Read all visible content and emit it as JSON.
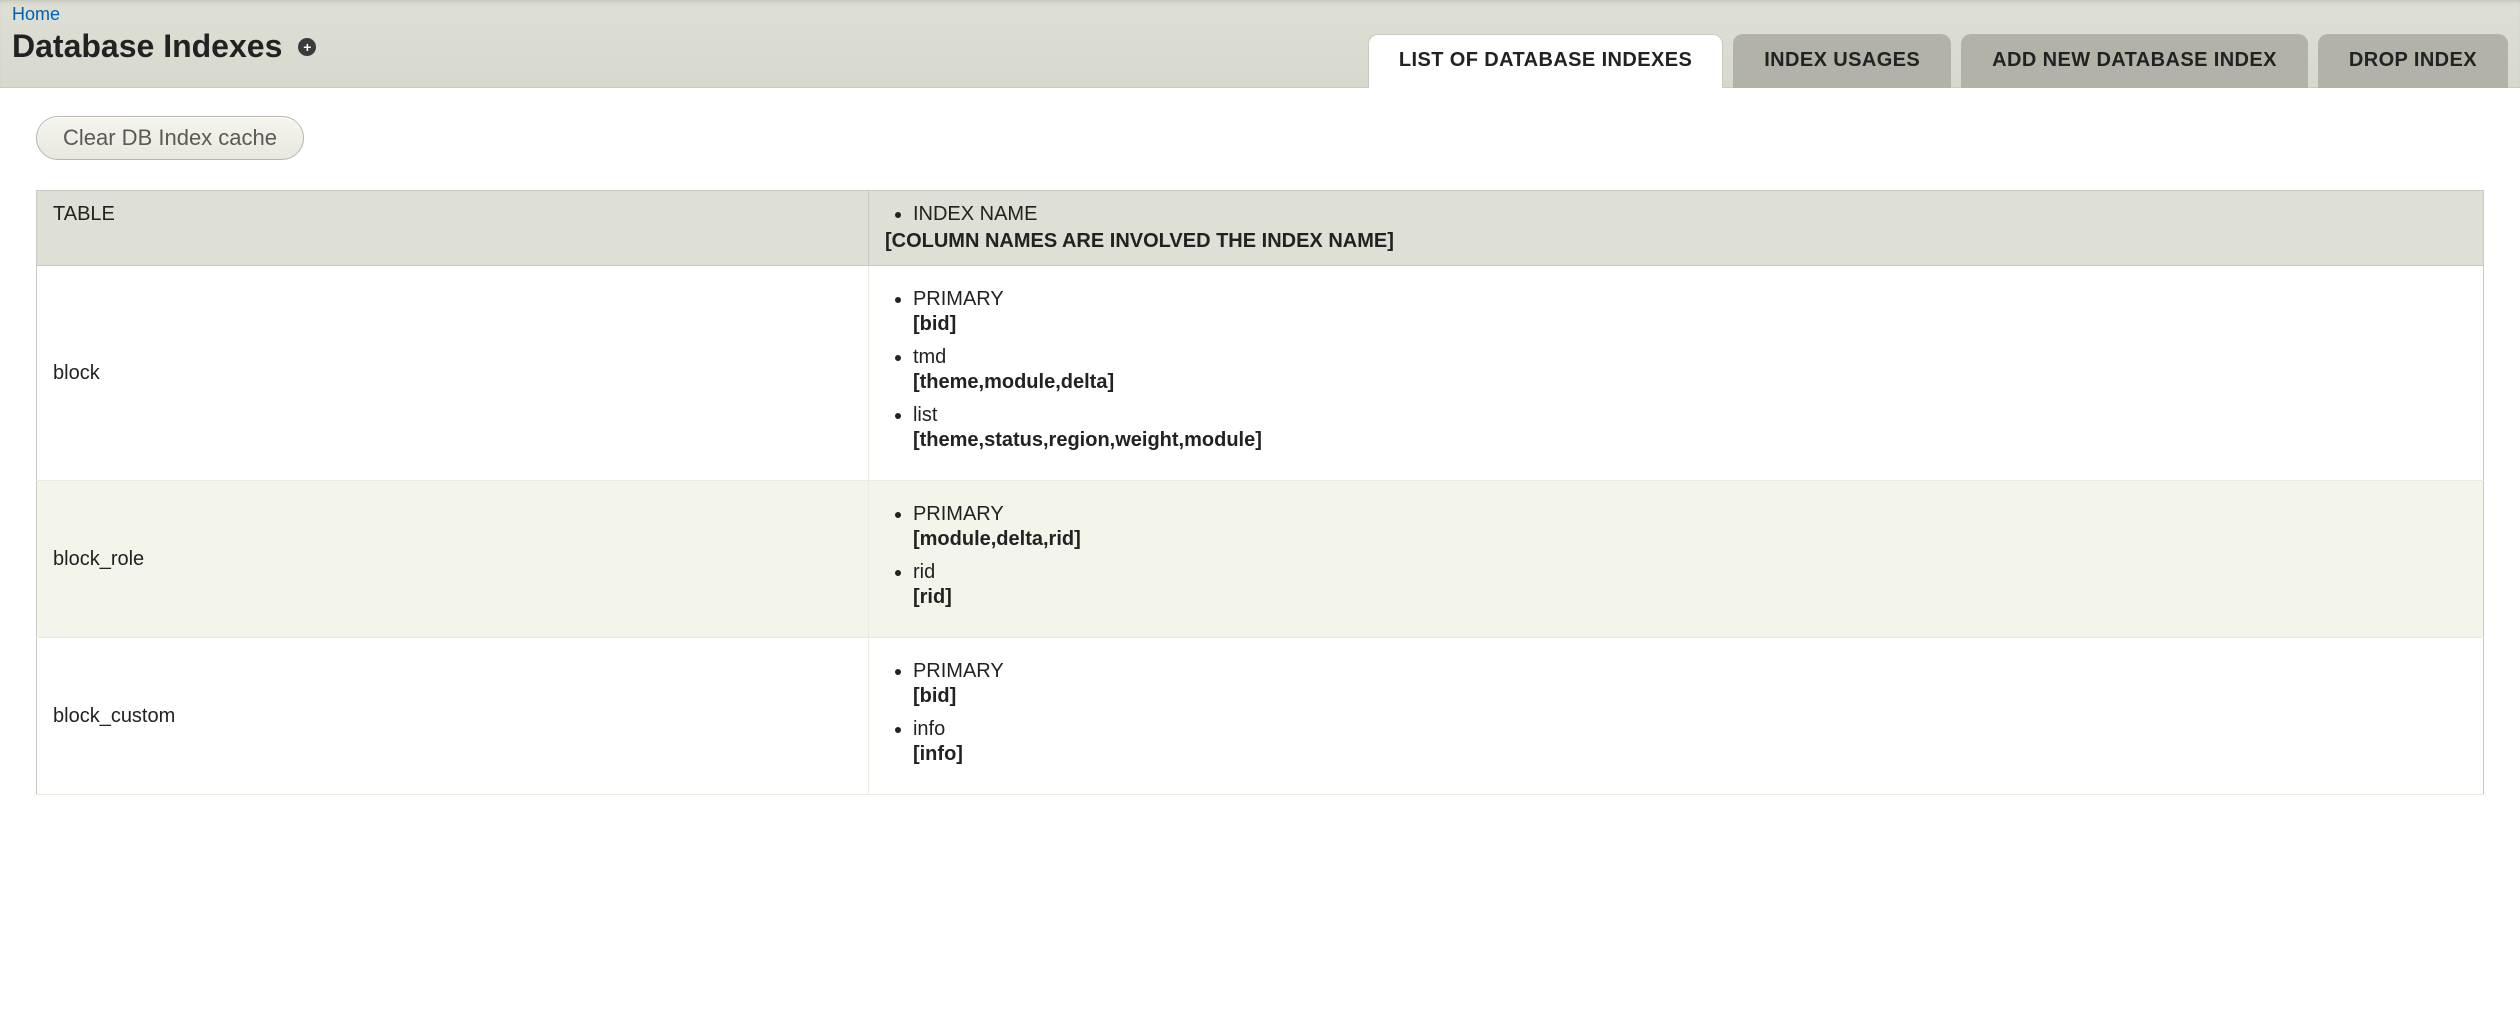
{
  "breadcrumb": {
    "home": "Home"
  },
  "page_title": "Database Indexes",
  "tabs": {
    "list": "LIST OF DATABASE INDEXES",
    "usage": "INDEX USAGES",
    "add": "ADD NEW DATABASE INDEX",
    "drop": "DROP INDEX"
  },
  "buttons": {
    "clear_cache": "Clear DB Index cache"
  },
  "table": {
    "headers": {
      "table_col": "TABLE",
      "index_name_bullet": "INDEX NAME",
      "index_name_sub": "[COLUMN NAMES ARE INVOLVED THE INDEX NAME]"
    },
    "rows": [
      {
        "table": "block",
        "indexes": [
          {
            "name": "PRIMARY",
            "columns": "[bid]"
          },
          {
            "name": "tmd",
            "columns": "[theme,module,delta]"
          },
          {
            "name": "list",
            "columns": "[theme,status,region,weight,module]"
          }
        ]
      },
      {
        "table": "block_role",
        "indexes": [
          {
            "name": "PRIMARY",
            "columns": "[module,delta,rid]"
          },
          {
            "name": "rid",
            "columns": "[rid]"
          }
        ]
      },
      {
        "table": "block_custom",
        "indexes": [
          {
            "name": "PRIMARY",
            "columns": "[bid]"
          },
          {
            "name": "info",
            "columns": "[info]"
          }
        ]
      }
    ]
  }
}
